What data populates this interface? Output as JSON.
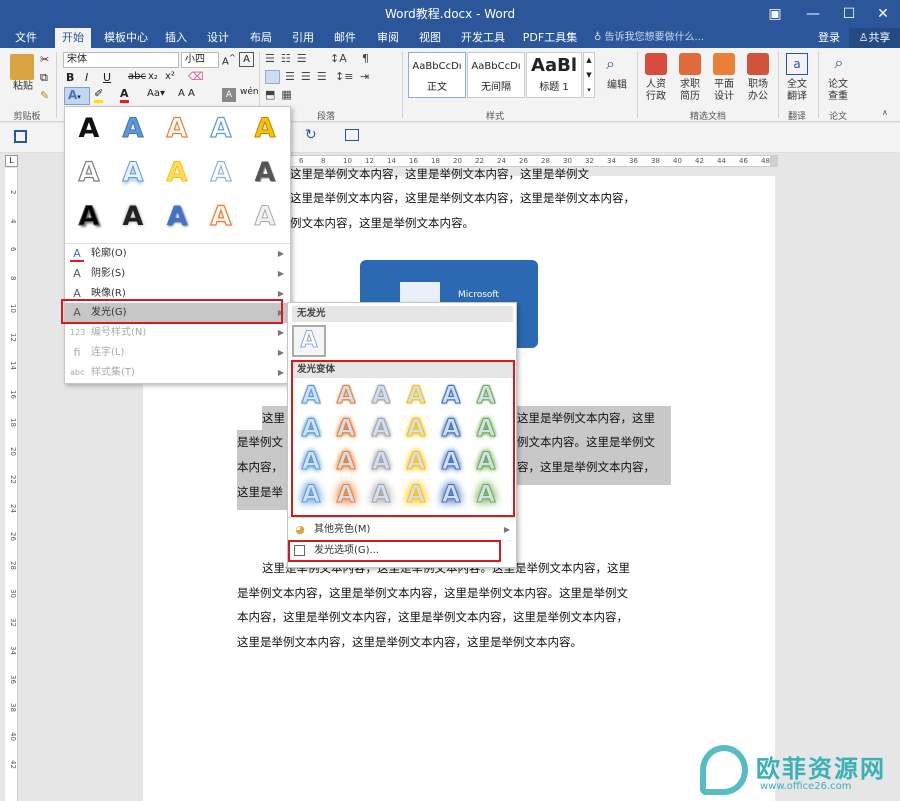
{
  "window": {
    "title": "Word教程.docx - Word",
    "buttons": [
      "▣",
      "—",
      "☐",
      "✕"
    ]
  },
  "tabs": [
    "文件",
    "开始",
    "模板中心",
    "插入",
    "设计",
    "布局",
    "引用",
    "邮件",
    "审阅",
    "视图",
    "开发工具",
    "PDF工具集"
  ],
  "tell_me": "告诉我您想要做什么...",
  "login": "登录",
  "share": "共享",
  "ribbon": {
    "paste": "粘贴",
    "font_name": "宋体",
    "font_size": "小四",
    "wen": "wén",
    "groups": {
      "clipboard": "剪贴板",
      "paragraph": "段落",
      "styles": "样式",
      "featured": "精选文档",
      "translate": "翻译",
      "paper": "论文"
    },
    "styles": [
      {
        "sample": "AaBbCcDı",
        "name": "正文"
      },
      {
        "sample": "AaBbCcDı",
        "name": "无间隔"
      },
      {
        "sample": "AaBl",
        "name": "标题 1"
      }
    ],
    "edit": "编辑",
    "featured_buttons": [
      {
        "top": "人资",
        "bottom": "行政"
      },
      {
        "top": "求职",
        "bottom": "简历"
      },
      {
        "top": "平面",
        "bottom": "设计"
      },
      {
        "top": "职场",
        "bottom": "办公"
      }
    ],
    "translate_button": {
      "top": "全文",
      "bottom": "翻译"
    },
    "paper_button": {
      "top": "论文",
      "bottom": "查重"
    }
  },
  "ruler_h": [
    "6",
    "8",
    "10",
    "12",
    "14",
    "16",
    "18",
    "20",
    "22",
    "24",
    "26",
    "28",
    "30",
    "32",
    "34",
    "36",
    "38",
    "40",
    "42",
    "44",
    "46",
    "48"
  ],
  "ruler_v": [
    "2",
    "4",
    "6",
    "8",
    "10",
    "12",
    "14",
    "16",
    "18",
    "20",
    "22",
    "24",
    "26",
    "28",
    "30",
    "32",
    "34",
    "36",
    "38",
    "40",
    "42"
  ],
  "doc": {
    "p0": [
      "这里是举例文本内容，这里是举例文本内容，这里是举例文",
      "这里是举例文本内容，这里是举例文本内容，这里是举例文本内容，",
      "例文本内容，这里是举例文本内容。"
    ],
    "image_text": "Microsoft",
    "p1_right": [
      "这里是举例文本内容，这里",
      "例文本内容。这里是举例文",
      "容，这里是举例文本内容，"
    ],
    "p1_left": [
      "这里",
      "是举例文",
      "本内容，",
      "这里是举"
    ],
    "p2": [
      "这里是举例文本内容，这里是举例文本内容。这里是举例文本内容，这里",
      "是举例文本内容，这里是举例文本内容，这里是举例文本内容。这里是举例文",
      "本内容，这里是举例文本内容，这里是举例文本内容，这里是举例文本内容，",
      "这里是举例文本内容，这里是举例文本内容，这里是举例文本内容。"
    ]
  },
  "effects_menu": {
    "items": [
      {
        "label": "轮廓(O)",
        "icon": "A"
      },
      {
        "label": "阴影(S)",
        "icon": "A"
      },
      {
        "label": "映像(R)",
        "icon": "A"
      },
      {
        "label": "发光(G)",
        "icon": "A"
      },
      {
        "label": "编号样式(N)",
        "icon": "123"
      },
      {
        "label": "连字(L)",
        "icon": "fi"
      },
      {
        "label": "样式集(T)",
        "icon": "abc"
      }
    ]
  },
  "glow_menu": {
    "no_glow": "无发光",
    "variants": "发光变体",
    "more_colors": "其他亮色(M)",
    "options": "发光选项(G)..."
  },
  "colors": {
    "accent": "#2b579a",
    "highlight": "#c8c8c8",
    "red_box": "#d61a1a"
  },
  "watermark": {
    "text": "欧菲资源网",
    "url": "www.office26.com"
  }
}
